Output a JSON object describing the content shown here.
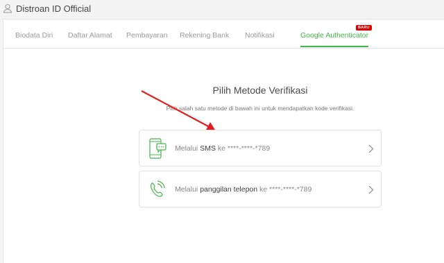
{
  "account": {
    "title": "Distroan ID Official",
    "icon": "user-icon"
  },
  "tabs": [
    {
      "label": "Biodata Diri",
      "active": false
    },
    {
      "label": "Daftar Alamat",
      "active": false
    },
    {
      "label": "Pembayaran",
      "active": false
    },
    {
      "label": "Rekening Bank",
      "active": false
    },
    {
      "label": "Notifikasi",
      "active": false
    },
    {
      "label": "Google Authenticator",
      "active": true,
      "badge": "BARU"
    }
  ],
  "verification": {
    "title": "Pilih Metode Verifikasi",
    "subtitle": "Pilih salah satu metode di bawah ini untuk mendapatkan kode verifikasi.",
    "methods": [
      {
        "prefix": "Melalui ",
        "channel": "SMS",
        "suffix": " ke ****-****-*789",
        "icon": "sms-phone-icon"
      },
      {
        "prefix": "Melalui ",
        "channel": "panggilan telepon",
        "suffix": " ke ****-****-*789",
        "icon": "phone-call-icon"
      }
    ]
  },
  "colors": {
    "accent": "#42b549",
    "annotation_arrow": "#e02020",
    "badge": "#d50000"
  }
}
